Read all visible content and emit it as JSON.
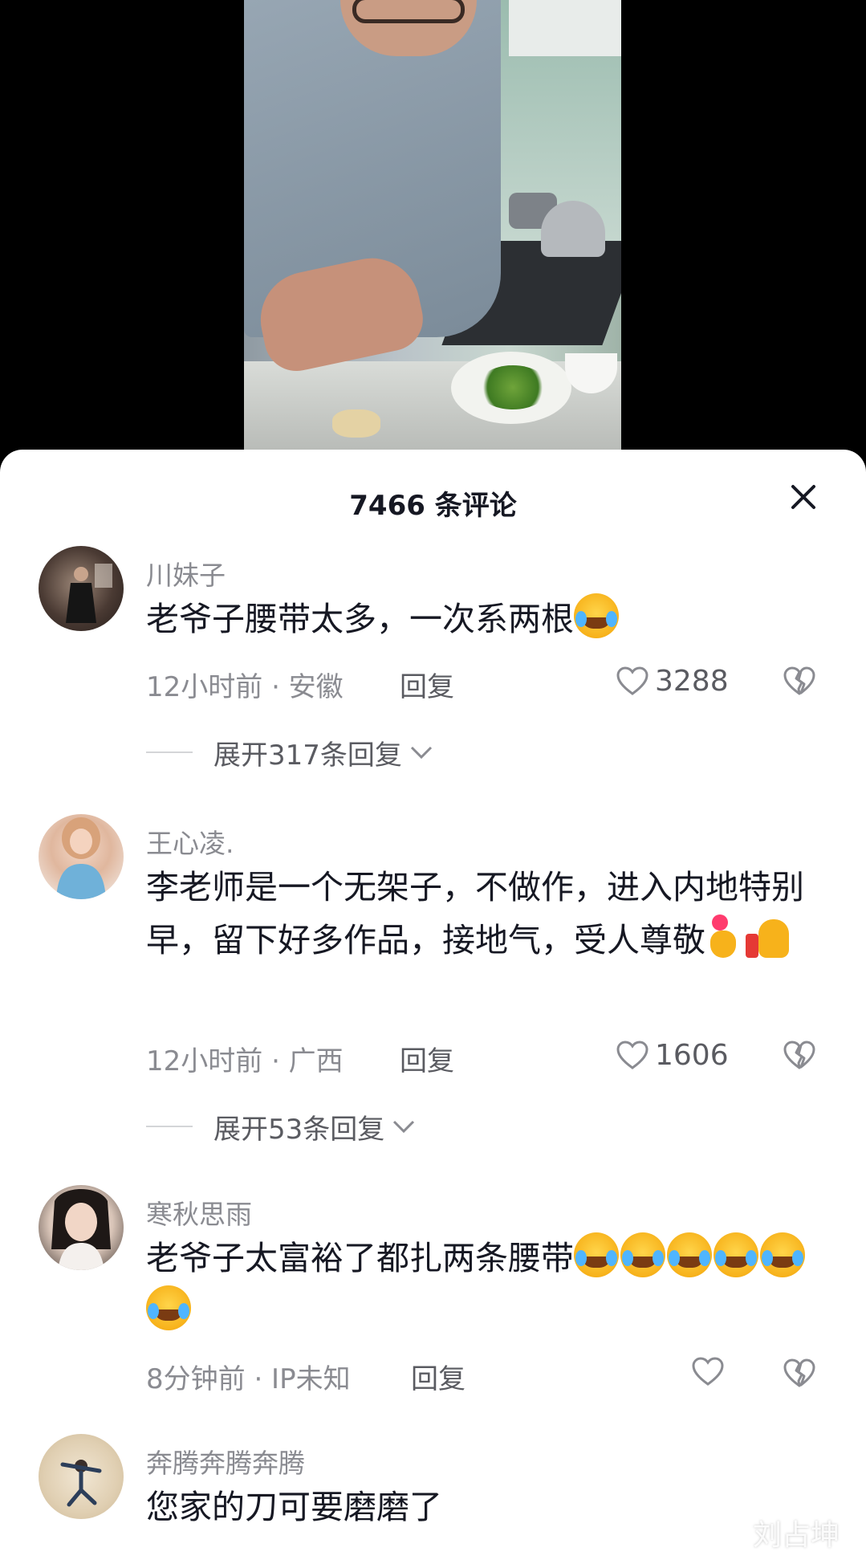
{
  "header": {
    "title": "7466 条评论"
  },
  "comments": [
    {
      "username": "川妹子",
      "text": "老爷子腰带太多，一次系两根",
      "emojis": [
        "rolling-laugh-emoji"
      ],
      "time_location": "12小时前 · 安徽",
      "reply_label": "回复",
      "likes": "3288",
      "expand_label": "展开317条回复",
      "avatar_colors": [
        "#3a2e2a",
        "#7d6a5c"
      ]
    },
    {
      "username": "王心凌.",
      "text": "李老师是一个无架子，不做作，进入内地特别早，留下好多作品，接地气，受人尊敬",
      "emojis": [
        "finger-heart-emoji",
        "thumbs-up-emoji"
      ],
      "time_location": "12小时前 · 广西",
      "reply_label": "回复",
      "likes": "1606",
      "expand_label": "展开53条回复",
      "avatar_colors": [
        "#e9c7b6",
        "#7fb6d6"
      ]
    },
    {
      "username": "寒秋思雨",
      "text": "老爷子太富裕了都扎两条腰带",
      "emojis": [
        "rolling-laugh-emoji",
        "rolling-laugh-emoji",
        "rolling-laugh-emoji",
        "rolling-laugh-emoji",
        "rolling-laugh-emoji",
        "rolling-laugh-emoji"
      ],
      "time_location": "8分钟前 · IP未知",
      "reply_label": "回复",
      "likes": "",
      "avatar_colors": [
        "#2a2220",
        "#eadfd8"
      ]
    },
    {
      "username": "奔腾奔腾奔腾",
      "text": "您家的刀可要磨磨了",
      "emojis": [],
      "avatar_colors": [
        "#e9dcc7",
        "#c9b99d"
      ]
    }
  ],
  "icons": {
    "close": "close-icon",
    "like": "heart-outline-icon",
    "dislike": "broken-heart-icon",
    "expand": "chevron-down-icon"
  },
  "watermark": "刘占坤",
  "colors": {
    "background": "#000000",
    "sheet": "#ffffff",
    "text_primary": "#161823",
    "text_secondary": "#8a8b91"
  }
}
